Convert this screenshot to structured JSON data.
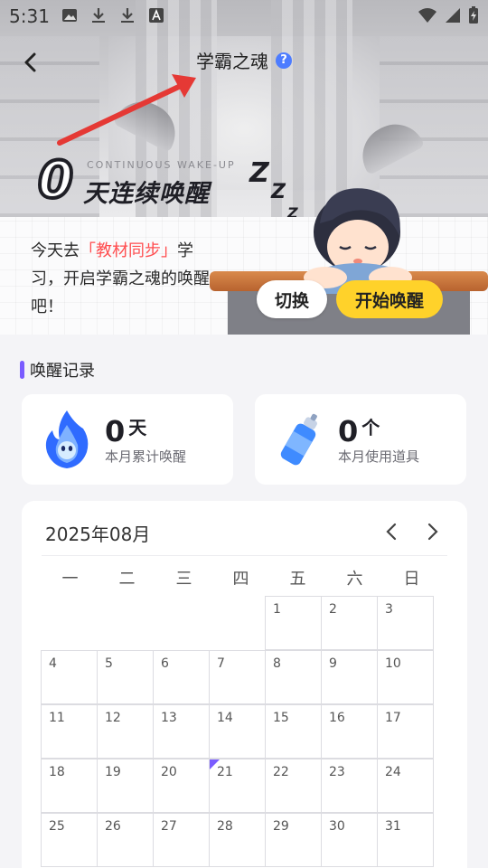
{
  "status_bar": {
    "time": "5:31"
  },
  "header": {
    "title": "学霸之魂",
    "help": "?"
  },
  "hero": {
    "streak_subtitle": "CONTINUOUS WAKE-UP",
    "streak_count": "0",
    "streak_label": "天连续唤醒",
    "prompt_pre": "今天去",
    "prompt_highlight": "「教材同步」",
    "prompt_post": "学习，开启学霸之魂的唤醒吧！",
    "switch_label": "切换",
    "start_label": "开始唤醒"
  },
  "records": {
    "title": "唤醒记录",
    "wakeups": {
      "value": "0",
      "unit": "天",
      "label": "本月累计唤醒"
    },
    "props": {
      "value": "0",
      "unit": "个",
      "label": "本月使用道具"
    }
  },
  "calendar": {
    "month": "2025年08月",
    "weekdays": [
      "一",
      "二",
      "三",
      "四",
      "五",
      "六",
      "日"
    ],
    "weeks": [
      [
        "",
        "",
        "",
        "",
        "1",
        "2",
        "3"
      ],
      [
        "4",
        "5",
        "6",
        "7",
        "8",
        "9",
        "10"
      ],
      [
        "11",
        "12",
        "13",
        "14",
        "15",
        "16",
        "17"
      ],
      [
        "18",
        "19",
        "20",
        "21",
        "22",
        "23",
        "24"
      ],
      [
        "25",
        "26",
        "27",
        "28",
        "29",
        "30",
        "31"
      ]
    ],
    "today": "21"
  },
  "colors": {
    "accent": "#7a5cff",
    "start_button": "#ffd22a",
    "highlight": "#ff4d4f",
    "help": "#4d7cff"
  }
}
